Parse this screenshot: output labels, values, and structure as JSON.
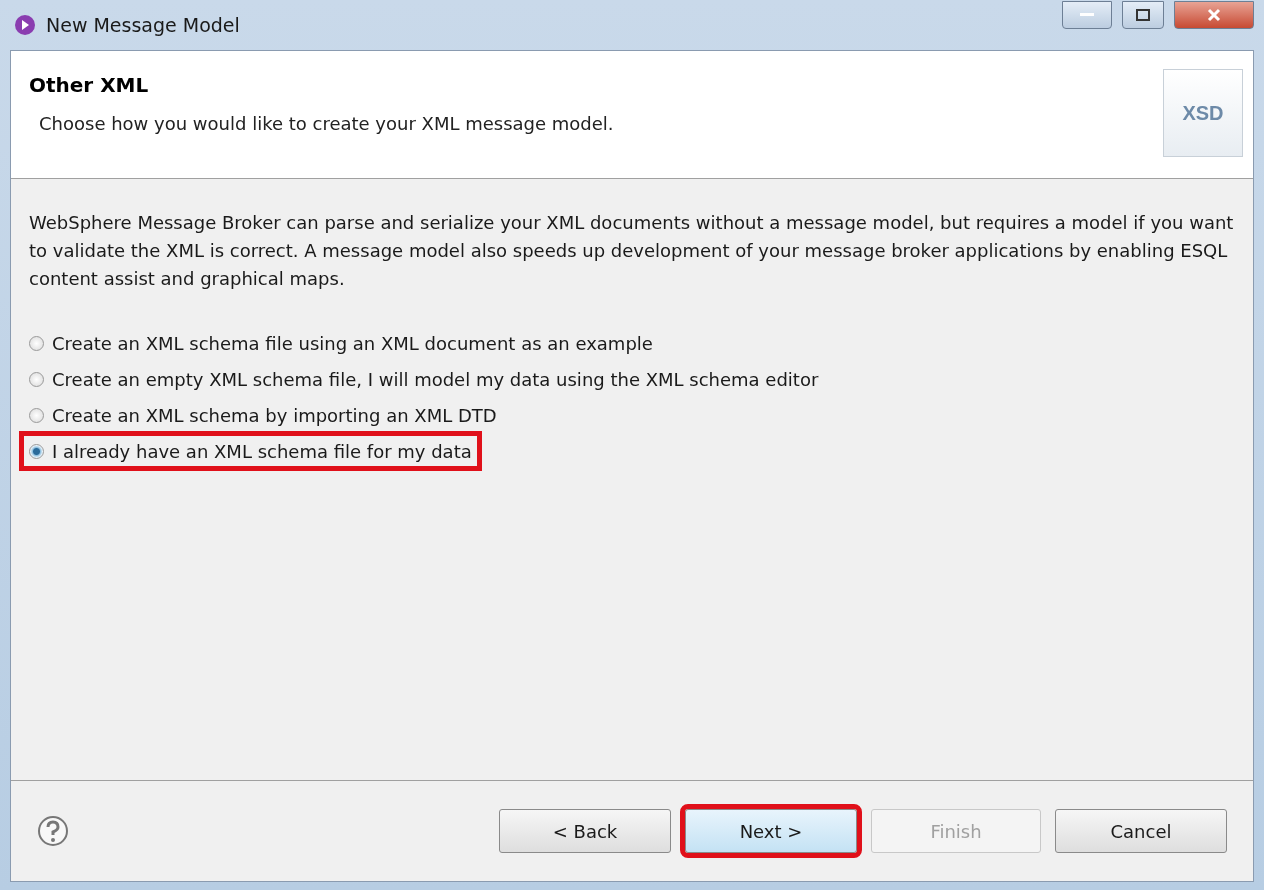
{
  "window": {
    "title": "New Message Model"
  },
  "header": {
    "title": "Other XML",
    "description": "Choose how you would like to create your XML message model.",
    "image_label": "XSD"
  },
  "intro": "WebSphere Message Broker can parse and serialize your XML documents without a message model, but requires a model if you want to validate the XML is correct. A message model also speeds up development of your message broker applications by enabling ESQL content assist and graphical maps.",
  "options": [
    {
      "label": "Create an XML schema file using an XML document as an example",
      "selected": false,
      "highlighted": false
    },
    {
      "label": "Create an empty XML schema file, I will model my data using the XML schema editor",
      "selected": false,
      "highlighted": false
    },
    {
      "label": "Create an XML schema by importing an XML DTD",
      "selected": false,
      "highlighted": false
    },
    {
      "label": "I already have an XML schema file for my data",
      "selected": true,
      "highlighted": true
    }
  ],
  "buttons": [
    {
      "label": "< Back",
      "disabled": false,
      "highlighted": false
    },
    {
      "label": "Next >",
      "disabled": false,
      "highlighted": true
    },
    {
      "label": "Finish",
      "disabled": true,
      "highlighted": false
    },
    {
      "label": "Cancel",
      "disabled": false,
      "highlighted": false
    }
  ]
}
